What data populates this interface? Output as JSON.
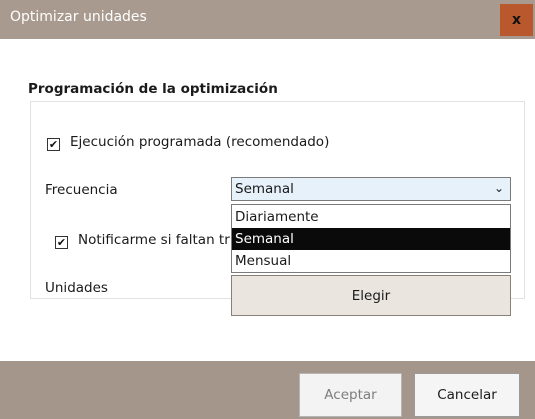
{
  "window": {
    "title": "Optimizar unidades",
    "close_glyph": "x"
  },
  "section": {
    "title": "Programación de la optimización"
  },
  "scheduled": {
    "checked": true,
    "check_glyph": "✔",
    "label": "Ejecución programada (recomendado)"
  },
  "frequency": {
    "label": "Frecuencia",
    "selected": "Semanal",
    "chevron": "⌄",
    "options": [
      "Diariamente",
      "Semanal",
      "Mensual"
    ],
    "selected_index": 1
  },
  "notify": {
    "checked": true,
    "check_glyph": "✔",
    "label": "Notificarme si faltan tr"
  },
  "units": {
    "label": "Unidades",
    "button_label": "Elegir"
  },
  "footer": {
    "accept_label": "Aceptar",
    "cancel_label": "Cancelar"
  },
  "colors": {
    "titlebar": "#a89a8e",
    "close": "#b9582c",
    "footer": "#a4968b",
    "select_bg": "#e6f1fa",
    "selected_option": "#0a0a0a"
  }
}
